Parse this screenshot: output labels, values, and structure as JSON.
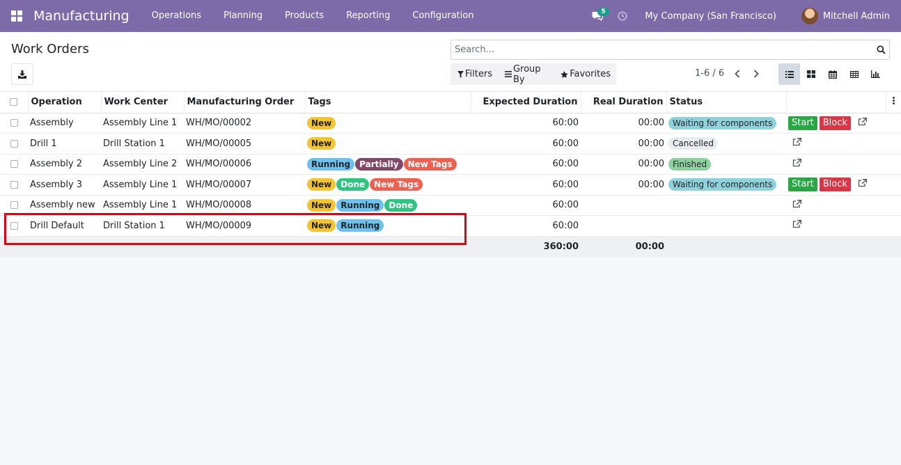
{
  "navbar": {
    "app_name": "Manufacturing",
    "menu": [
      "Operations",
      "Planning",
      "Products",
      "Reporting",
      "Configuration"
    ],
    "messages_count": "5",
    "company": "My Company (San Francisco)",
    "user": "Mitchell Admin",
    "bg_color": "#7c6ba8"
  },
  "control": {
    "title": "Work Orders",
    "search_placeholder": "Search...",
    "filters_label": "Filters",
    "groupby_label": "Group By",
    "favorites_label": "Favorites",
    "pager": "1-6 / 6"
  },
  "table": {
    "columns": [
      "Operation",
      "Work Center",
      "Manufacturing Order",
      "Tags",
      "Expected Duration",
      "Real Duration",
      "Status"
    ],
    "rows": [
      {
        "operation": "Assembly",
        "work_center": "Assembly Line 1",
        "mo": "WH/MO/00002",
        "tags": [
          {
            "label": "New",
            "color": "#f4c430",
            "text": "#212529"
          }
        ],
        "expected": "60:00",
        "real": "00:00",
        "status": {
          "label": "Waiting for components",
          "color": "#8fd1da"
        },
        "start_label": "Start",
        "block_label": "Block"
      },
      {
        "operation": "Drill 1",
        "work_center": "Drill Station 1",
        "mo": "WH/MO/00005",
        "tags": [
          {
            "label": "New",
            "color": "#f4c430",
            "text": "#212529"
          }
        ],
        "expected": "60:00",
        "real": "00:00",
        "status": {
          "label": "Cancelled",
          "color": "#e9ecef"
        },
        "start_label": "",
        "block_label": ""
      },
      {
        "operation": "Assembly 2",
        "work_center": "Assembly Line 2",
        "mo": "WH/MO/00006",
        "tags": [
          {
            "label": "Running",
            "color": "#6cc1ed",
            "text": "#212529"
          },
          {
            "label": "Partially",
            "color": "#814968",
            "text": "#ffffff"
          },
          {
            "label": "New Tags",
            "color": "#f06050",
            "text": "#ffffff"
          }
        ],
        "expected": "60:00",
        "real": "00:00",
        "status": {
          "label": "Finished",
          "color": "#8fd19e"
        },
        "start_label": "",
        "block_label": ""
      },
      {
        "operation": "Assembly 3",
        "work_center": "Assembly Line 1",
        "mo": "WH/MO/00007",
        "tags": [
          {
            "label": "New",
            "color": "#f4c430",
            "text": "#212529"
          },
          {
            "label": "Done",
            "color": "#30c381",
            "text": "#ffffff"
          },
          {
            "label": "New Tags",
            "color": "#f06050",
            "text": "#ffffff"
          }
        ],
        "expected": "60:00",
        "real": "00:00",
        "status": {
          "label": "Waiting for components",
          "color": "#8fd1da"
        },
        "start_label": "Start",
        "block_label": "Block"
      },
      {
        "operation": "Assembly new",
        "work_center": "Assembly Line 1",
        "mo": "WH/MO/00008",
        "tags": [
          {
            "label": "New",
            "color": "#f4c430",
            "text": "#212529"
          },
          {
            "label": "Running",
            "color": "#6cc1ed",
            "text": "#212529"
          },
          {
            "label": "Done",
            "color": "#30c381",
            "text": "#ffffff"
          }
        ],
        "expected": "60:00",
        "real": "",
        "status": {
          "label": "",
          "color": ""
        },
        "start_label": "",
        "block_label": ""
      },
      {
        "operation": "Drill Default",
        "work_center": "Drill Station 1",
        "mo": "WH/MO/00009",
        "tags": [
          {
            "label": "New",
            "color": "#f4c430",
            "text": "#212529"
          },
          {
            "label": "Running",
            "color": "#6cc1ed",
            "text": "#212529"
          }
        ],
        "expected": "60:00",
        "real": "",
        "status": {
          "label": "",
          "color": ""
        },
        "start_label": "",
        "block_label": ""
      }
    ],
    "totals": {
      "expected": "360:00",
      "real": "00:00"
    }
  }
}
